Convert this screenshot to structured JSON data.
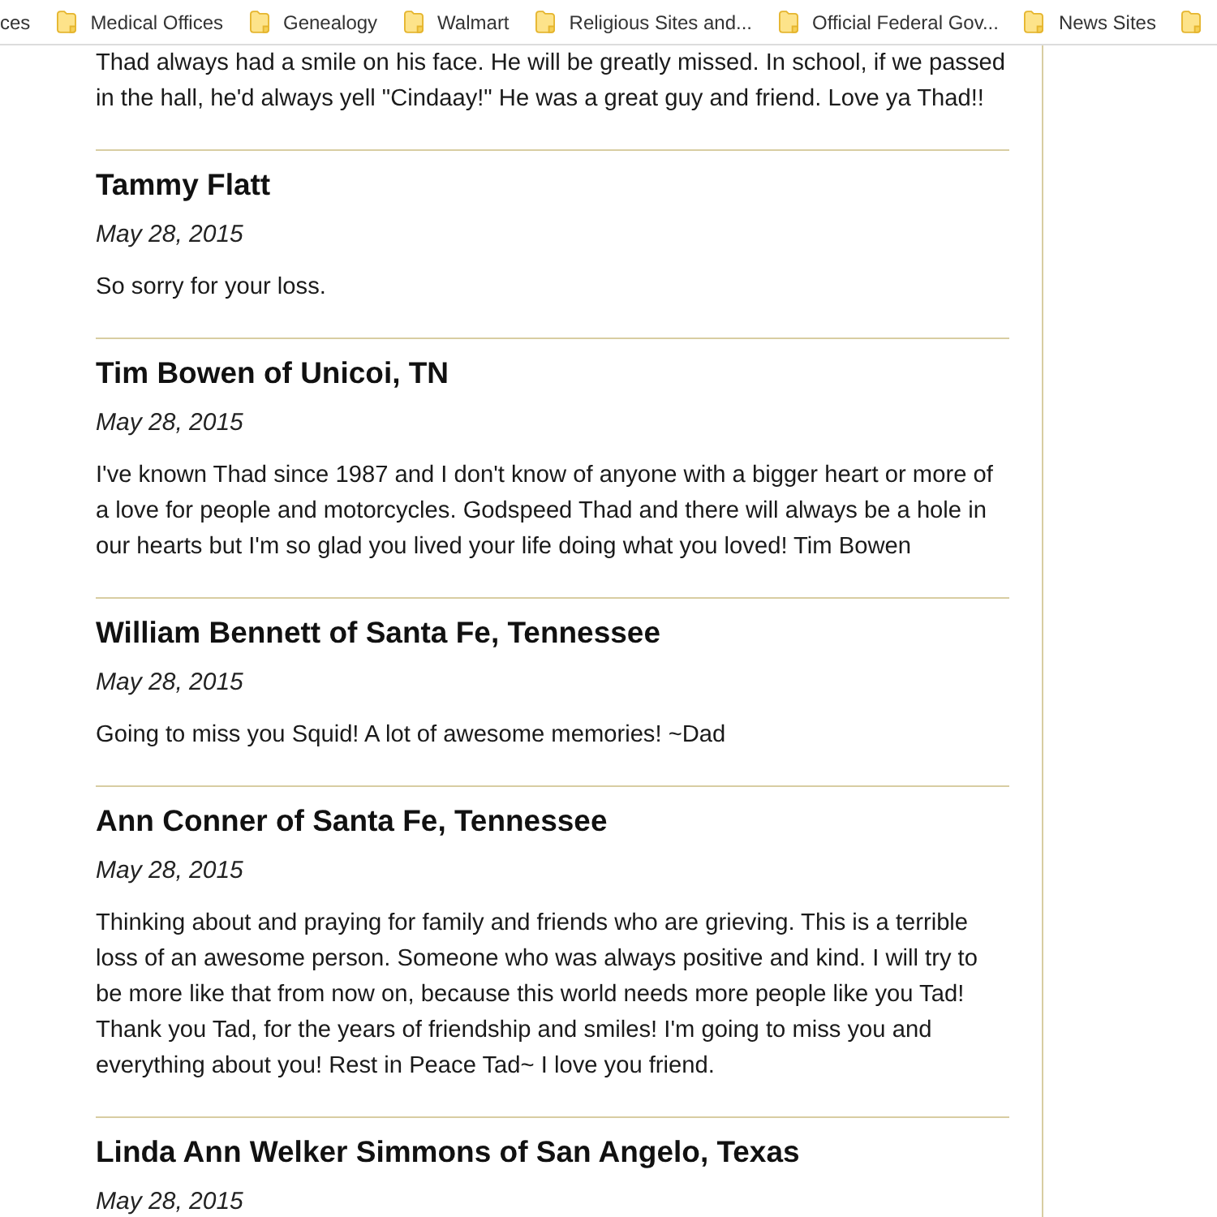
{
  "bookmarks_bar": {
    "items": [
      {
        "kind": "cut",
        "label": "ces"
      },
      {
        "kind": "folder",
        "label": "Medical Offices"
      },
      {
        "kind": "folder",
        "label": "Genealogy"
      },
      {
        "kind": "folder",
        "label": "Walmart"
      },
      {
        "kind": "folder",
        "label": "Religious Sites and..."
      },
      {
        "kind": "folder",
        "label": "Official Federal Gov..."
      },
      {
        "kind": "folder",
        "label": "News Sites"
      },
      {
        "kind": "folder"
      }
    ]
  },
  "comments": [
    {
      "text": "Thad always had a smile on his face. He will be greatly missed. In school, if we passed in the hall, he'd always yell \"Cindaay!\" He was a great guy and friend. Love ya Thad!!"
    },
    {
      "name": "Tammy Flatt",
      "date": "May 28, 2015",
      "text": "So sorry for your loss."
    },
    {
      "name": "Tim Bowen of Unicoi, TN",
      "date": "May 28, 2015",
      "text": "I've known Thad since 1987 and I don't know of anyone with a bigger heart or more of a love for people and motorcycles. Godspeed Thad and there will always be a hole in our hearts but I'm so glad you lived your life doing what you loved! Tim Bowen"
    },
    {
      "name": "William Bennett of Santa Fe, Tennessee",
      "date": "May 28, 2015",
      "text": "Going to miss you Squid! A lot of awesome memories! ~Dad"
    },
    {
      "name": "Ann Conner of Santa Fe, Tennessee",
      "date": "May 28, 2015",
      "text": "Thinking about and praying for family and friends who are grieving. This is a terrible loss of an awesome person. Someone who was always positive and kind. I will try to be more like that from now on, because this world needs more people like you Tad! Thank you Tad, for the years of friendship and smiles! I'm going to miss you and everything about you! Rest in Peace Tad~ I love you friend."
    },
    {
      "name": "Linda Ann Welker Simmons of San Angelo, Texas",
      "date": "May 28, 2015"
    }
  ]
}
